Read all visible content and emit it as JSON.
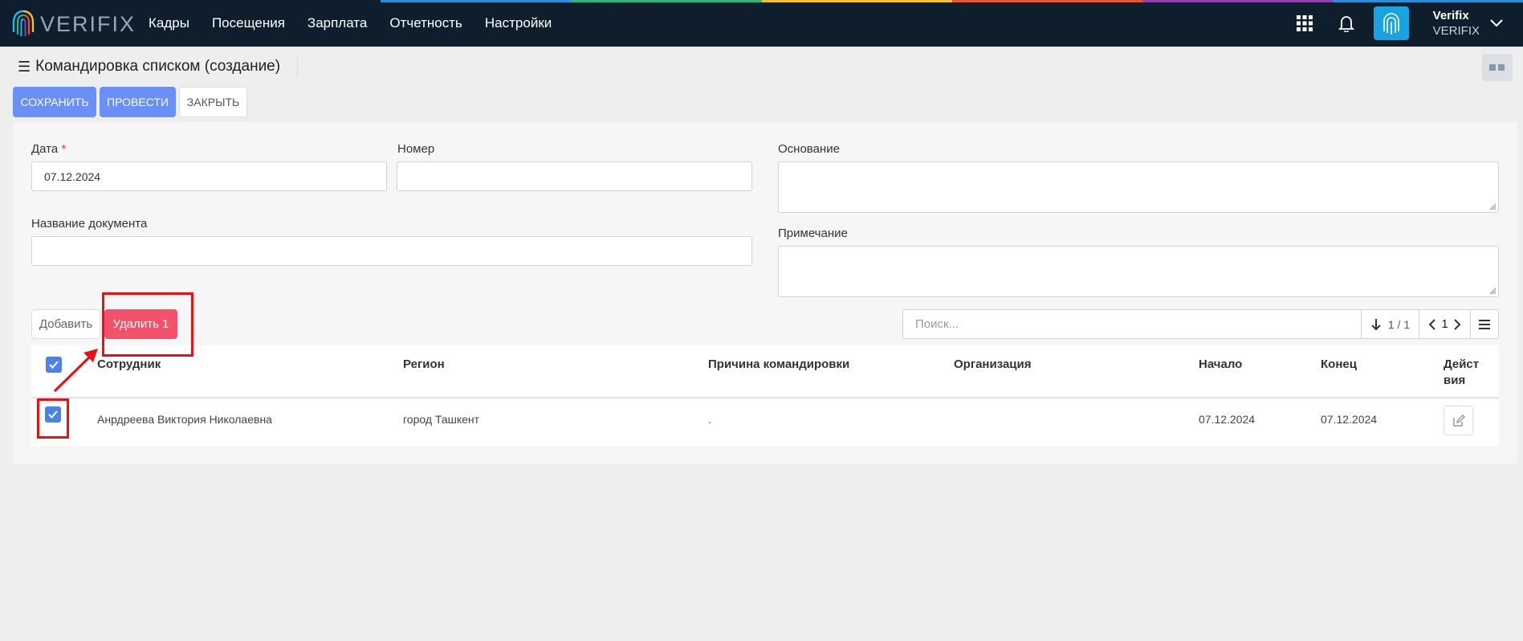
{
  "brand": {
    "logo_text": "VERIFIX"
  },
  "nav": [
    "Кадры",
    "Посещения",
    "Зарплата",
    "Отчетность",
    "Настройки"
  ],
  "user": {
    "name": "Verifix",
    "org": "VERIFIX"
  },
  "page": {
    "title": "Командировка списком (создание)"
  },
  "actions": {
    "save": "СОХРАНИТЬ",
    "post": "ПРОВЕСТИ",
    "close": "ЗАКРЫТЬ"
  },
  "form": {
    "date": {
      "label": "Дата",
      "required_mark": "*",
      "value": "07.12.2024"
    },
    "number": {
      "label": "Номер",
      "value": ""
    },
    "basis": {
      "label": "Основание",
      "value": ""
    },
    "doc_name": {
      "label": "Название документа",
      "value": ""
    },
    "note": {
      "label": "Примечание",
      "value": ""
    }
  },
  "list": {
    "add_label": "Добавить",
    "delete_label": "Удалить 1",
    "search_placeholder": "Поиск...",
    "count": "1 / 1",
    "page": "1"
  },
  "table": {
    "columns": [
      "Сотрудник",
      "Регион",
      "Причина командировки",
      "Организация",
      "Начало",
      "Конец",
      "Действия"
    ],
    "actions_col_line1": "Дейст",
    "actions_col_line2": "вия",
    "rows": [
      {
        "employee": "Анрдреева Виктория Николаевна",
        "region": "город Ташкент",
        "reason": ".",
        "organization": "",
        "start": "07.12.2024",
        "end": "07.12.2024",
        "selected": true
      }
    ]
  },
  "colors": {
    "topbar": "#0f1e2d",
    "primary": "#6a8ff7",
    "danger": "#f2536a",
    "highlight": "#ee0f13",
    "checkbox": "#4b82e6"
  },
  "icons": [
    "fingerprint-logo-icon",
    "apps-grid-icon",
    "bell-icon",
    "fingerprint-icon",
    "chevron-down-icon",
    "menu-icon",
    "translate-icon",
    "sort-down-icon",
    "chevron-left-icon",
    "chevron-right-icon",
    "list-menu-icon",
    "checkbox-checked-icon",
    "edit-icon"
  ]
}
